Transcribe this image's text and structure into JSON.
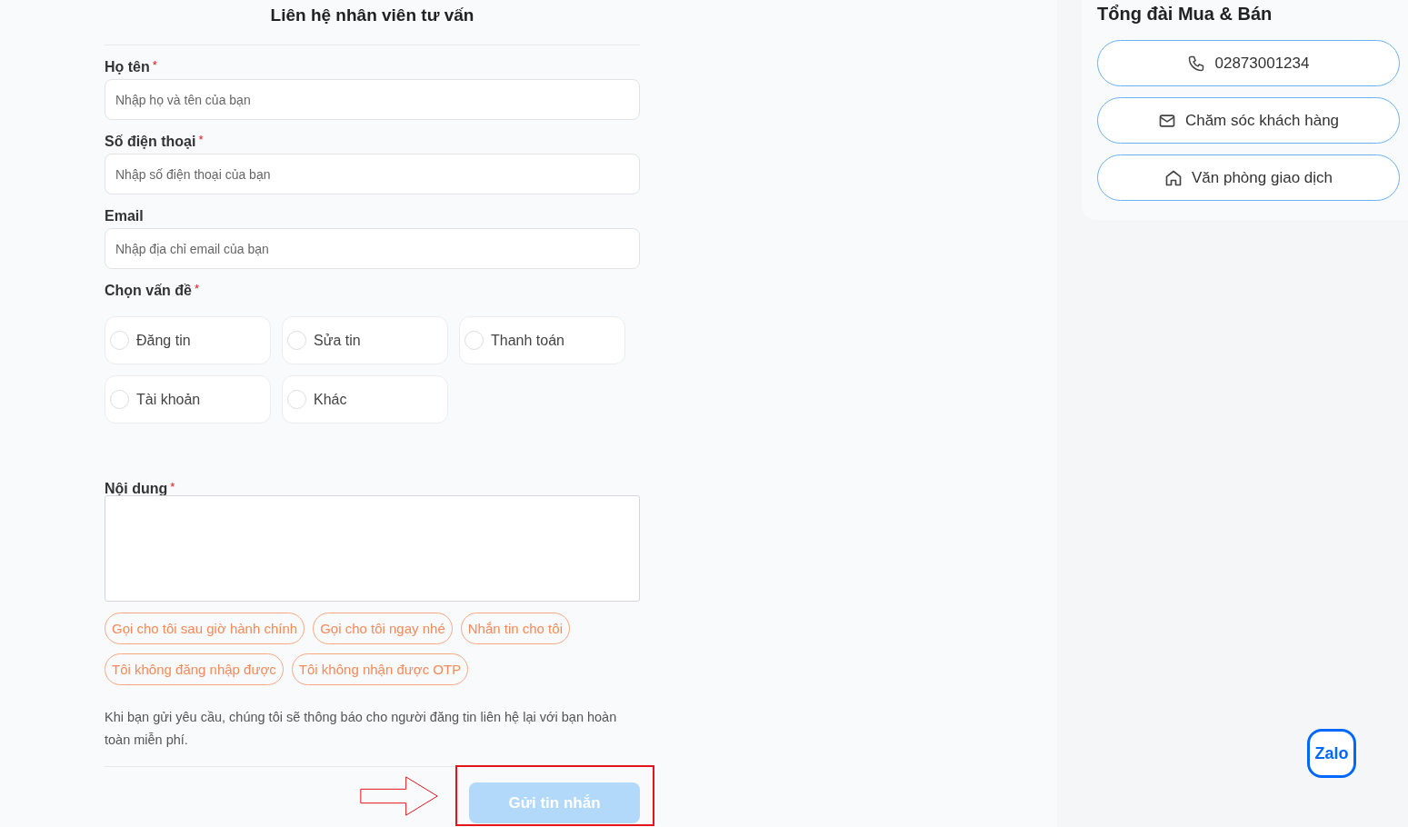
{
  "form": {
    "title": "Liên hệ nhân viên tư vấn",
    "fields": [
      {
        "label": "Họ tên",
        "required_mark": "*",
        "placeholder": "Nhập họ và tên của bạn"
      },
      {
        "label": "Số điện thoại",
        "required_mark": "*",
        "placeholder": "Nhập số điện thoại của bạn"
      },
      {
        "label": "Email",
        "placeholder": "Nhập địa chỉ email của bạn"
      }
    ],
    "topic": {
      "label": "Chọn vấn đề",
      "required_mark": "*",
      "options": [
        {
          "label": "Đăng tin",
          "selected": false
        },
        {
          "label": "Sửa tin",
          "selected": false
        },
        {
          "label": "Thanh toán",
          "selected": false
        },
        {
          "label": "Tài khoản",
          "selected": false
        },
        {
          "label": "Khác",
          "selected": false
        }
      ]
    },
    "content": {
      "label": "Nội dung",
      "required_mark": "*"
    },
    "quick_replies": [
      "Gọi cho tôi sau giờ hành chính",
      "Gọi cho tôi ngay nhé",
      "Nhắn tin cho tôi",
      "Tôi không đăng nhập được",
      "Tôi không nhận được OTP"
    ],
    "notice": "Khi bạn gửi yêu cầu, chúng tôi sẽ thông báo cho người đăng tin liên hệ lại với bạn hoàn toàn miễn phí.",
    "submit": {
      "label": "Gửi tin nhắn",
      "disabled": true
    }
  },
  "hotline": {
    "title": "Tổng đài Mua & Bán",
    "buttons": [
      {
        "kind": "phone",
        "label": "02873001234"
      },
      {
        "kind": "mail",
        "label": "Chăm sóc khách hàng"
      },
      {
        "kind": "home",
        "label": "Văn phòng giao dịch"
      }
    ]
  },
  "zalo": {
    "label": "Zalo"
  }
}
